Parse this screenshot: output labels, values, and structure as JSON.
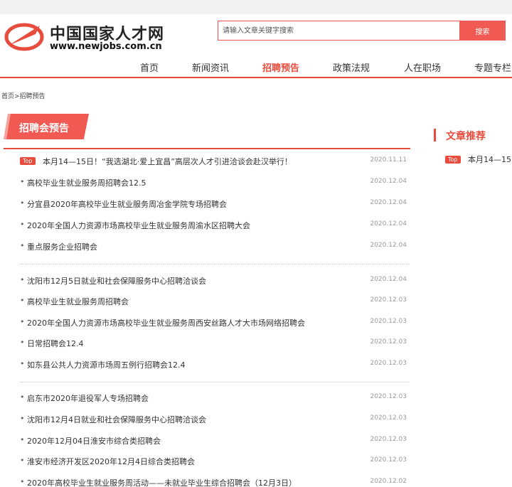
{
  "header": {
    "logo_cn": "中国国家人才网",
    "logo_en": "www.newjobs.com.cn",
    "search_placeholder": "请输入文章关键字搜索",
    "search_button": "搜索",
    "brand_color": "#e84c3d"
  },
  "nav": {
    "items": [
      "首页",
      "新闻资讯",
      "招聘预告",
      "政策法规",
      "人在职场",
      "专题专栏"
    ],
    "active": "招聘预告"
  },
  "breadcrumb": "首页>招聘预告",
  "main": {
    "section_title": "招聘会预告",
    "top_badge": "Top",
    "items": [
      {
        "title": "本月14—15日！“我选湖北·爱上宜昌”高层次人才引进洽谈会赴汉举行！",
        "date": "2020.11.11",
        "top": true
      },
      {
        "title": "高校毕业生就业服务周招聘会12.5",
        "date": "2020.12.04"
      },
      {
        "title": "分宜县2020年高校毕业生就业服务周冶金学院专场招聘会",
        "date": "2020.12.04"
      },
      {
        "title": "2020年全国人力资源市场高校毕业生就业服务周渝水区招聘大会",
        "date": "2020.12.04"
      },
      {
        "title": "重点服务企业招聘会",
        "date": "2020.12.04"
      },
      {
        "title": "沈阳市12月5日就业和社会保障服务中心招聘洽谈会",
        "date": "2020.12.04"
      },
      {
        "title": "高校毕业生就业服务周招聘会",
        "date": "2020.12.03"
      },
      {
        "title": "2020年全国人力资源市场高校毕业生就业服务周西安丝路人才大市场网络招聘会",
        "date": "2020.12.03"
      },
      {
        "title": "日常招聘会12.4",
        "date": "2020.12.03"
      },
      {
        "title": "如东县公共人力资源市场周五例行招聘会12.4",
        "date": "2020.12.03"
      },
      {
        "title": "启东市2020年退役军人专场招聘会",
        "date": "2020.12.03"
      },
      {
        "title": "沈阳市12月4日就业和社会保障服务中心招聘洽谈会",
        "date": "2020.12.03"
      },
      {
        "title": "2020年12月04日淮安市综合类招聘会",
        "date": "2020.12.03"
      },
      {
        "title": "淮安市经济开发区2020年12月4日综合类招聘会",
        "date": "2020.12.03"
      },
      {
        "title": "2020年高校毕业生就业服务周活动——未就业毕业生综合招聘会（12月3日）",
        "date": "2020.12.02"
      }
    ]
  },
  "sidebar": {
    "title": "文章推荐",
    "top_badge": "Top",
    "item_title": "本月14—15"
  }
}
